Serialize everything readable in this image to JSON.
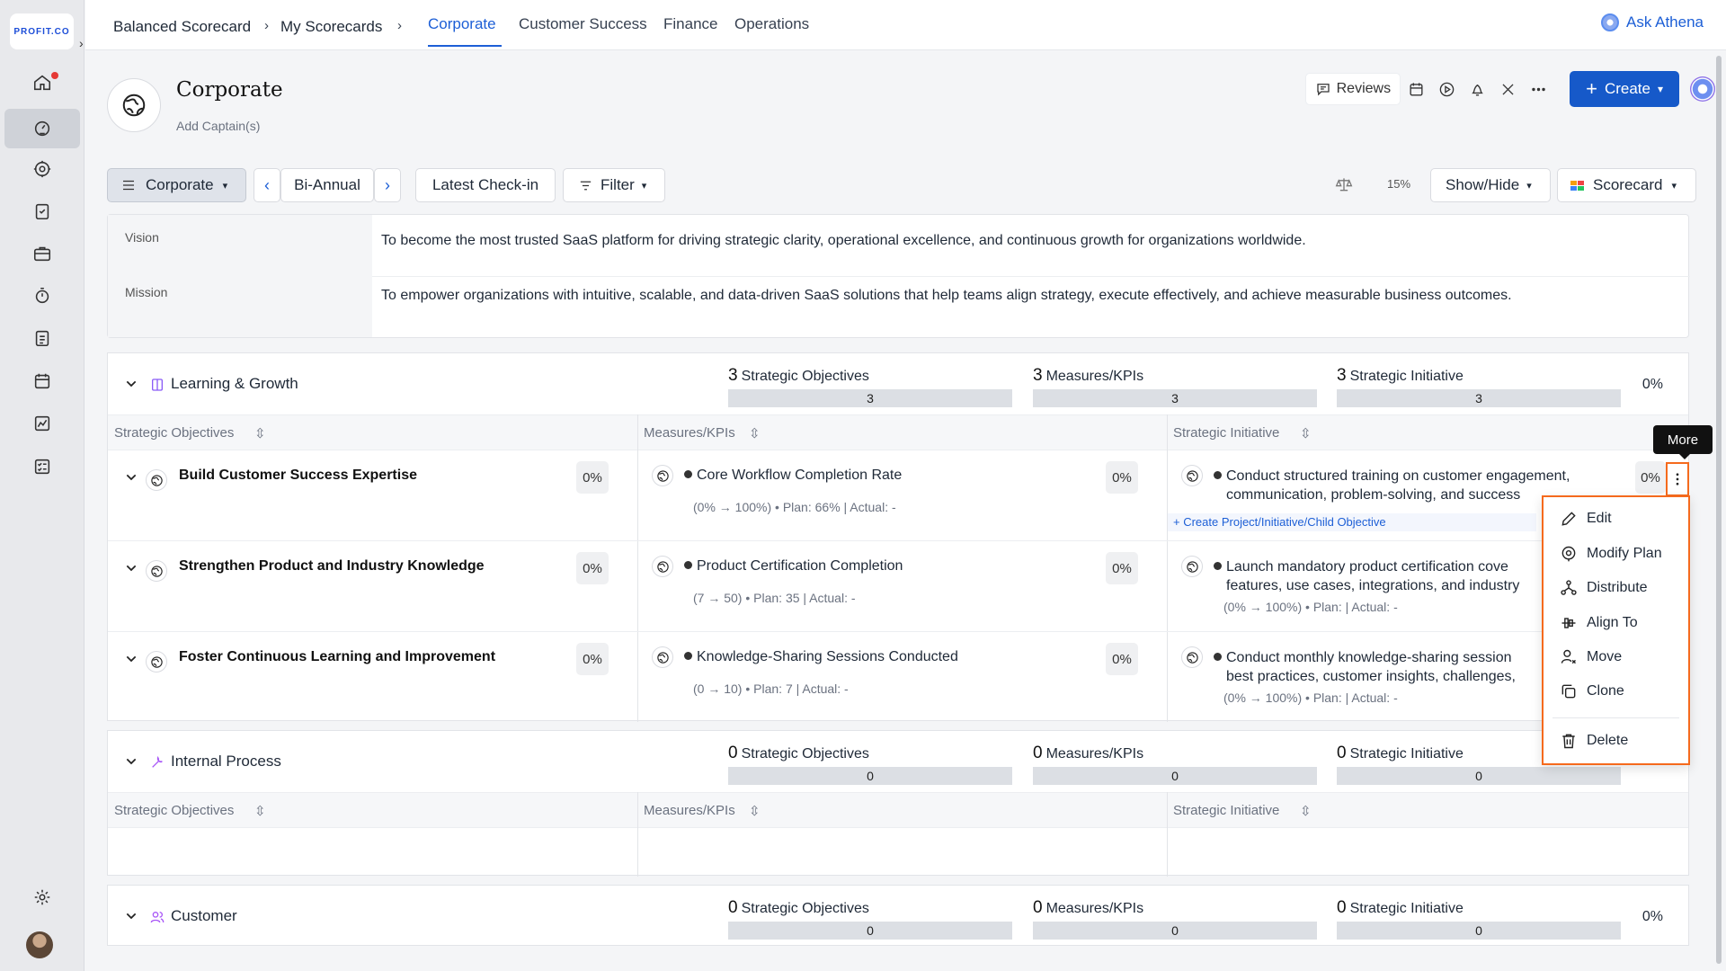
{
  "app": {
    "logo": "PROFIT.CO"
  },
  "breadcrumb": [
    "Balanced Scorecard",
    "My Scorecards"
  ],
  "tabs": [
    {
      "label": "Corporate",
      "active": true
    },
    {
      "label": "Customer Success"
    },
    {
      "label": "Finance"
    },
    {
      "label": "Operations"
    }
  ],
  "ask_athena": "Ask Athena",
  "header": {
    "title": "Corporate",
    "add_captains": "Add Captain(s)",
    "reviews": "Reviews",
    "create": "Create"
  },
  "toolbar": {
    "scorecard": "Corporate",
    "period": "Bi-Annual",
    "checkin": "Latest Check-in",
    "filter": "Filter",
    "weight": "15%",
    "showhide": "Show/Hide",
    "view": "Scorecard"
  },
  "vision": {
    "label": "Vision",
    "text": "To become the most trusted SaaS platform for driving strategic clarity, operational excellence, and continuous growth for organizations worldwide."
  },
  "mission": {
    "label": "Mission",
    "text": "To empower organizations with intuitive, scalable, and data-driven SaaS solutions that help teams align strategy, execute effectively, and achieve measurable business outcomes."
  },
  "columns": {
    "objectives": "Strategic Objectives",
    "kpis": "Measures/KPIs",
    "initiatives": "Strategic Initiative"
  },
  "perspectives": [
    {
      "name": "Learning & Growth",
      "objectives_count": "3",
      "objectives_label": "Strategic Objectives",
      "objectives_bar": "3",
      "kpis_count": "3",
      "kpis_label": "Measures/KPIs",
      "kpis_bar": "3",
      "initiatives_count": "3",
      "initiatives_label": "Strategic Initiative",
      "initiatives_bar": "3",
      "progress": "0%",
      "rows": [
        {
          "objective": "Build Customer Success Expertise",
          "objective_pct": "0%",
          "kpi": "Core Workflow Completion Rate",
          "kpi_pct": "0%",
          "kpi_sub": "(0% → 100%) • Plan: 66% | Actual: -",
          "initiative_line1": "Conduct structured training on customer engagement,",
          "initiative_line2": "communication, problem-solving, and success",
          "initiative_pct": "0%"
        },
        {
          "objective": "Strengthen Product and Industry Knowledge",
          "objective_pct": "0%",
          "kpi": "Product Certification Completion",
          "kpi_pct": "0%",
          "kpi_sub": "(7 → 50) • Plan: 35 | Actual: -",
          "initiative_line1": "Launch mandatory product certification cove",
          "initiative_line2": "features, use cases, integrations, and industry",
          "initiative_sub": "(0% → 100%) • Plan:   | Actual: -"
        },
        {
          "objective": "Foster Continuous Learning and Improvement",
          "objective_pct": "0%",
          "kpi": "Knowledge-Sharing Sessions Conducted",
          "kpi_pct": "0%",
          "kpi_sub": "(0 → 10) • Plan: 7 | Actual: -",
          "initiative_line1": "Conduct monthly knowledge-sharing session",
          "initiative_line2": "best practices, customer insights, challenges,",
          "initiative_sub": "(0% → 100%) • Plan:   | Actual: -"
        }
      ],
      "create_link": "+ Create Project/Initiative/Child Objective"
    },
    {
      "name": "Internal Process",
      "objectives_count": "0",
      "objectives_label": "Strategic Objectives",
      "objectives_bar": "0",
      "kpis_count": "0",
      "kpis_label": "Measures/KPIs",
      "kpis_bar": "0",
      "initiatives_count": "0",
      "initiatives_label": "Strategic Initiative",
      "initiatives_bar": "0"
    },
    {
      "name": "Customer",
      "objectives_count": "0",
      "objectives_label": "Strategic Objectives",
      "objectives_bar": "0",
      "kpis_count": "0",
      "kpis_label": "Measures/KPIs",
      "kpis_bar": "0",
      "initiatives_count": "0",
      "initiatives_label": "Strategic Initiative",
      "initiatives_bar": "0",
      "progress": "0%"
    }
  ],
  "more_tooltip": "More",
  "more_menu": [
    "Edit",
    "Modify Plan",
    "Distribute",
    "Align To",
    "Move",
    "Clone",
    "Delete"
  ],
  "colors": {
    "accent": "#1659c9",
    "highlight": "#f56a1d"
  }
}
